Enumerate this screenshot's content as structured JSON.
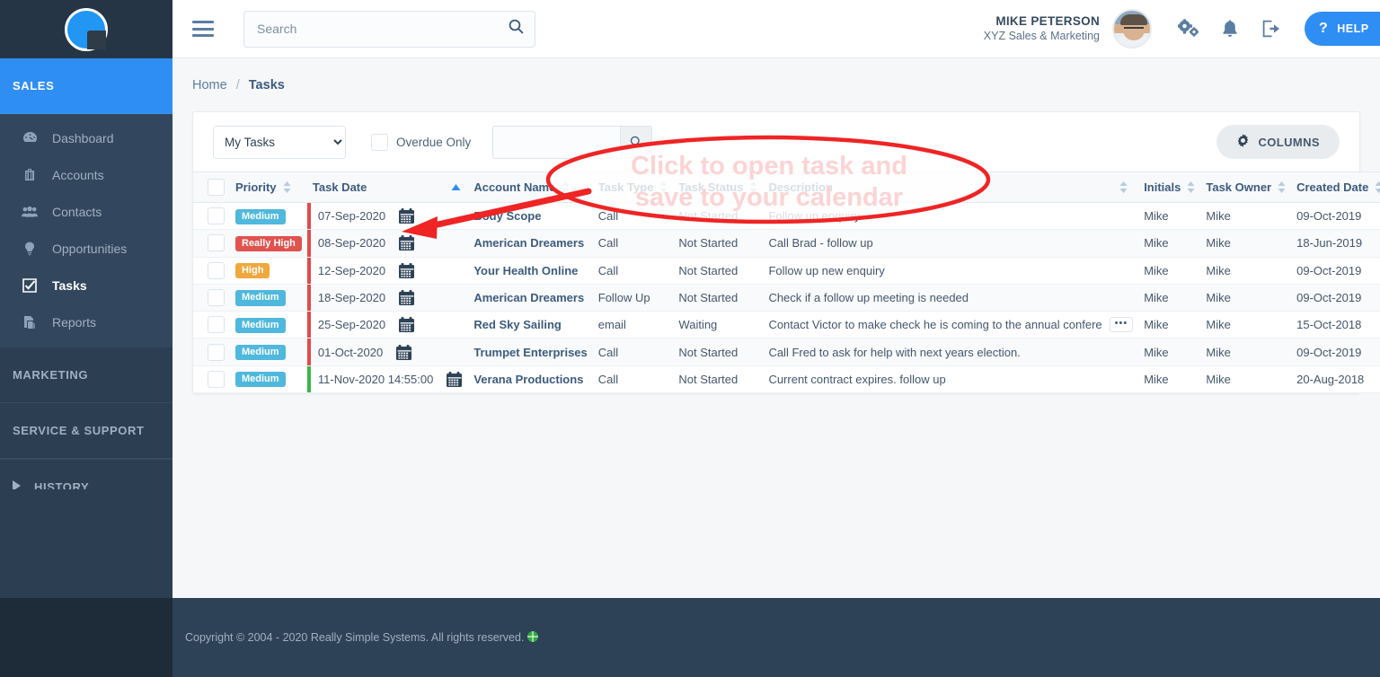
{
  "app": {
    "logo_name": "really-simple-systems-logo"
  },
  "topbar": {
    "menu_icon": "hamburger-icon",
    "search": {
      "placeholder": "Search",
      "value": "",
      "icon": "search-icon"
    },
    "user_name": "MIKE PETERSON",
    "user_org": "XYZ Sales & Marketing",
    "avatar_alt": "user-avatar",
    "settings_icon": "gears-icon",
    "notifications_icon": "bell-icon",
    "logout_icon": "logout-icon",
    "help_label": "HELP",
    "help_mark": "?"
  },
  "sidebar": {
    "sections": [
      {
        "label": "SALES",
        "active": true
      },
      {
        "label": "MARKETING",
        "active": false
      },
      {
        "label": "SERVICE & SUPPORT",
        "active": false
      }
    ],
    "items": [
      {
        "label": "Dashboard",
        "icon": "dashboard-icon",
        "selected": false
      },
      {
        "label": "Accounts",
        "icon": "briefcase-icon",
        "selected": false
      },
      {
        "label": "Contacts",
        "icon": "people-icon",
        "selected": false
      },
      {
        "label": "Opportunities",
        "icon": "lightbulb-icon",
        "selected": false
      },
      {
        "label": "Tasks",
        "icon": "checkbox-icon",
        "selected": true
      },
      {
        "label": "Reports",
        "icon": "documents-icon",
        "selected": false
      }
    ],
    "history_label": "HISTORY",
    "history_icon": "triangle-right-icon"
  },
  "breadcrumb": {
    "home": "Home",
    "separator": "/",
    "current": "Tasks"
  },
  "filters": {
    "view_selected": "My Tasks",
    "view_options": [
      "My Tasks"
    ],
    "overdue_label": "Overdue Only",
    "overdue_checked": false,
    "search_value": "",
    "search_placeholder": "",
    "search_icon": "search-icon",
    "columns_label": "COLUMNS",
    "columns_icon": "gear-icon"
  },
  "table": {
    "columns": [
      {
        "label": "",
        "name": "select-all",
        "sortable": false
      },
      {
        "label": "Priority",
        "name": "priority",
        "sortable": true
      },
      {
        "label": "Task Date",
        "name": "task-date",
        "sortable": true,
        "sorted": "asc"
      },
      {
        "label": "Account Name",
        "name": "account-name",
        "sortable": true
      },
      {
        "label": "Task Type",
        "name": "task-type",
        "sortable": true
      },
      {
        "label": "Task Status",
        "name": "task-status",
        "sortable": true
      },
      {
        "label": "Description",
        "name": "description",
        "sortable": true
      },
      {
        "label": "Initials",
        "name": "initials",
        "sortable": true
      },
      {
        "label": "Task Owner",
        "name": "task-owner",
        "sortable": true
      },
      {
        "label": "Created Date",
        "name": "created-date",
        "sortable": true
      },
      {
        "label": "",
        "name": "expand",
        "sortable": true
      }
    ],
    "rows": [
      {
        "priority": "Medium",
        "priority_color": "#4fb8dd",
        "bar_color": "#e04b4b",
        "task_date": "07-Sep-2020",
        "calendar_icon": "calendar-icon",
        "account_name": "Body Scope",
        "task_type": "Call",
        "task_status": "Not Started",
        "description": "Follow up enquiry.",
        "truncated": false,
        "initials": "Mike",
        "task_owner": "Mike",
        "created_date": "09-Oct-2019",
        "expand_icon": "plus-square-icon"
      },
      {
        "priority": "Really High",
        "priority_color": "#e0534f",
        "bar_color": "#e04b4b",
        "task_date": "08-Sep-2020",
        "calendar_icon": "calendar-icon",
        "account_name": "American Dreamers",
        "task_type": "Call",
        "task_status": "Not Started",
        "description": "Call Brad - follow up",
        "truncated": false,
        "initials": "Mike",
        "task_owner": "Mike",
        "created_date": "18-Jun-2019",
        "expand_icon": "plus-square-icon"
      },
      {
        "priority": "High",
        "priority_color": "#efa83c",
        "bar_color": "#e04b4b",
        "task_date": "12-Sep-2020",
        "calendar_icon": "calendar-icon",
        "account_name": "Your Health Online",
        "task_type": "Call",
        "task_status": "Not Started",
        "description": "Follow up new enquiry",
        "truncated": false,
        "initials": "Mike",
        "task_owner": "Mike",
        "created_date": "09-Oct-2019",
        "expand_icon": "plus-square-icon"
      },
      {
        "priority": "Medium",
        "priority_color": "#4fb8dd",
        "bar_color": "#e04b4b",
        "task_date": "18-Sep-2020",
        "calendar_icon": "calendar-icon",
        "account_name": "American Dreamers",
        "task_type": "Follow Up",
        "task_status": "Not Started",
        "description": "Check if a follow up meeting is needed",
        "truncated": false,
        "initials": "Mike",
        "task_owner": "Mike",
        "created_date": "09-Oct-2019",
        "expand_icon": "plus-square-icon"
      },
      {
        "priority": "Medium",
        "priority_color": "#4fb8dd",
        "bar_color": "#e04b4b",
        "task_date": "25-Sep-2020",
        "calendar_icon": "calendar-icon",
        "account_name": "Red Sky Sailing",
        "task_type": "email",
        "task_status": "Waiting",
        "description": "Contact Victor to make check he is coming to the annual confere",
        "truncated": true,
        "more_label": "•••",
        "initials": "Mike",
        "task_owner": "Mike",
        "created_date": "15-Oct-2018",
        "expand_icon": "plus-square-icon"
      },
      {
        "priority": "Medium",
        "priority_color": "#4fb8dd",
        "bar_color": "#e04b4b",
        "task_date": "01-Oct-2020",
        "calendar_icon": "calendar-icon",
        "account_name": "Trumpet Enterprises",
        "task_type": "Call",
        "task_status": "Not Started",
        "description": "Call Fred to ask for help with next years election.",
        "truncated": false,
        "initials": "Mike",
        "task_owner": "Mike",
        "created_date": "09-Oct-2019",
        "expand_icon": "plus-square-icon"
      },
      {
        "priority": "Medium",
        "priority_color": "#4fb8dd",
        "bar_color": "#3cb54a",
        "task_date": "11-Nov-2020 14:55:00",
        "calendar_icon": "calendar-icon",
        "account_name": "Verana Productions",
        "task_type": "Call",
        "task_status": "Not Started",
        "description": "Current contract expires. follow up",
        "truncated": false,
        "initials": "Mike",
        "task_owner": "Mike",
        "created_date": "20-Aug-2018",
        "expand_icon": "plus-square-icon"
      }
    ]
  },
  "annotation": {
    "line1": "Click to open task and",
    "line2": "save to your calendar",
    "color": "#ef2424",
    "shape": "ellipse-with-arrow"
  },
  "footer": {
    "copyright": "Copyright © 2004 - 2020 Really Simple Systems. All rights reserved.",
    "globe_icon": "globe-icon"
  }
}
